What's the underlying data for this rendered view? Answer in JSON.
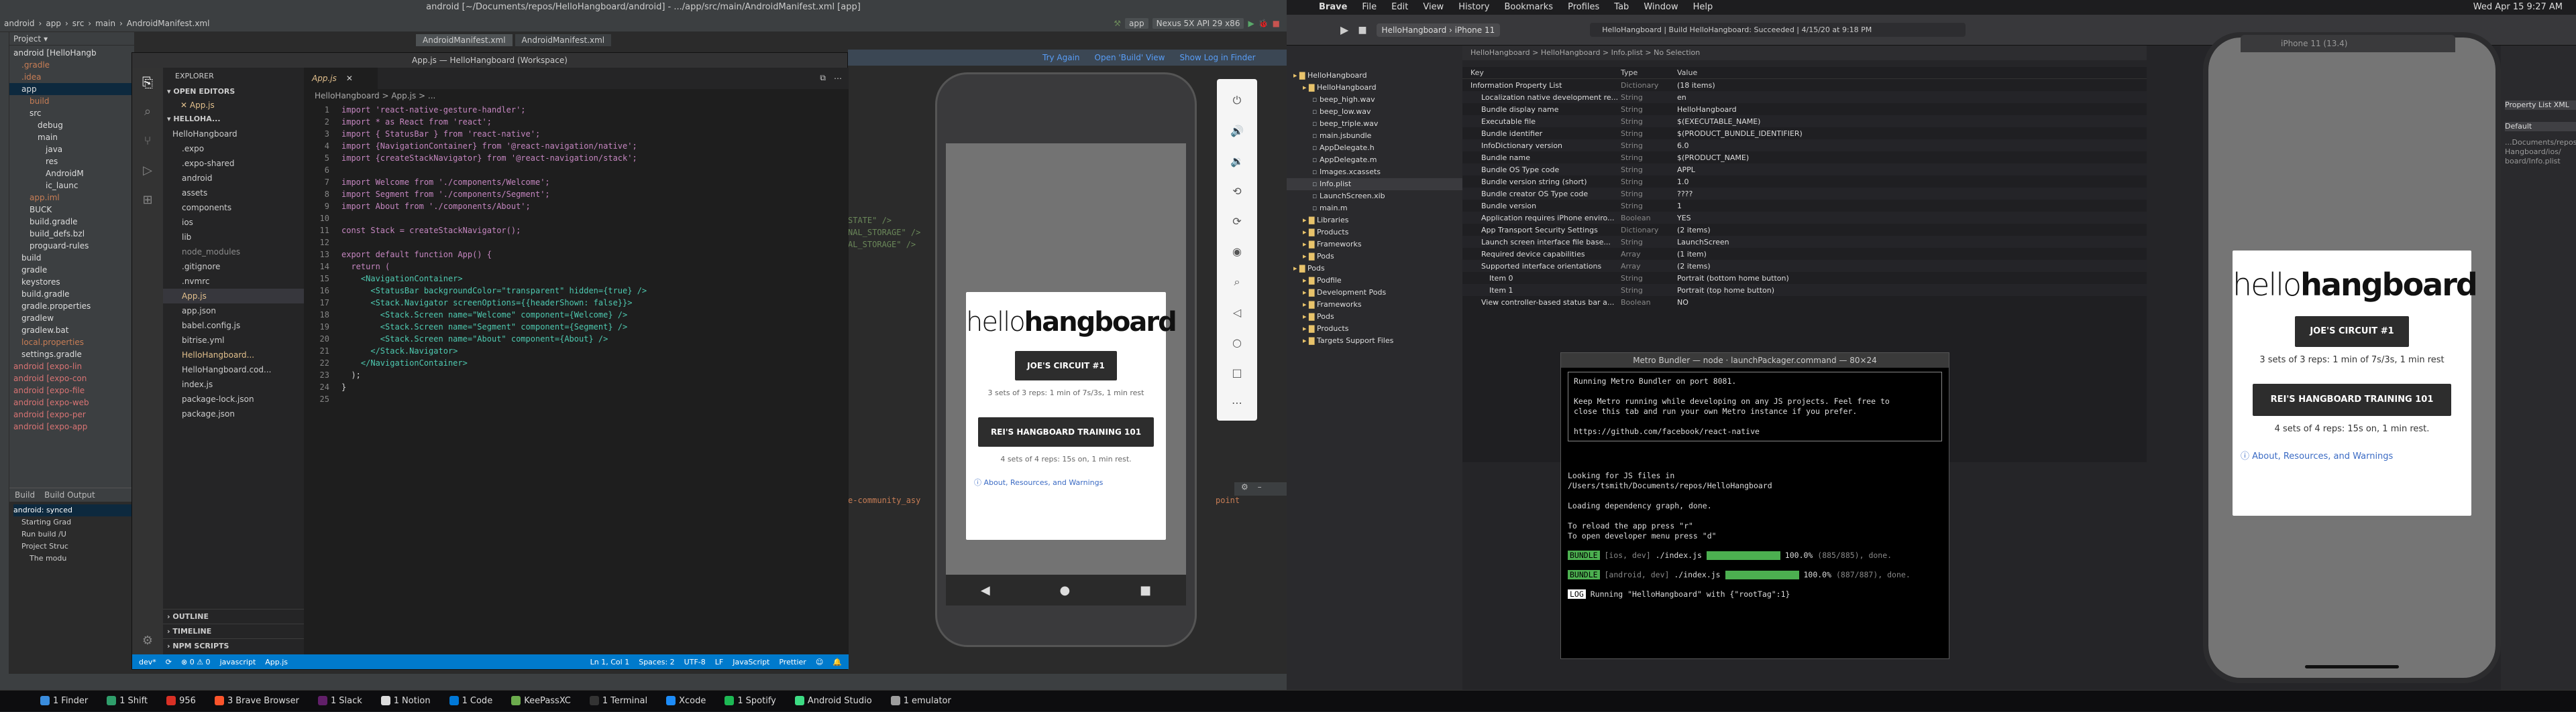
{
  "android_studio": {
    "title": "android [~/Documents/repos/HelloHangboard/android] - .../app/src/main/AndroidManifest.xml [app]",
    "breadcrumbs": [
      "android",
      "app",
      "src",
      "main",
      "AndroidManifest.xml"
    ],
    "run_config": "app",
    "device": "Nexus 5X API 29 x86",
    "editor_tabs": [
      "AndroidManifest.xml",
      "AndroidManifest.xml"
    ],
    "notice": {
      "try_again": "Try Again",
      "open_build": "Open 'Build' View",
      "show_log": "Show Log in Finder"
    },
    "project_label": "Project",
    "project_tree": [
      "android [HelloHangb",
      ".gradle",
      ".idea",
      "app",
      "build",
      "src",
      "debug",
      "main",
      "java",
      "res",
      "AndroidM",
      "ic_launc",
      "app.iml",
      "BUCK",
      "build.gradle",
      "build_defs.bzl",
      "proguard-rules",
      "build",
      "gradle",
      "keystores",
      "build.gradle",
      "gradle.properties",
      "gradlew",
      "gradlew.bat",
      "local.properties",
      "settings.gradle",
      "android [expo-lin",
      "android [expo-con",
      "android [expo-file",
      "android [expo-web",
      "android [expo-per",
      "android [expo-app"
    ],
    "build_tabs": [
      "Build",
      "Build Output"
    ],
    "build_tree": [
      "android: synced",
      "Starting Grad",
      "Run build /U",
      "Project Struc",
      "The modu"
    ],
    "code_fragments": [
      "STATE\" />",
      "NAL_STORAGE\" />",
      "AL_STORAGE\" />",
      "e-community_asy",
      "point"
    ]
  },
  "vscode": {
    "title": "App.js — HelloHangboard (Workspace)",
    "explorer_label": "EXPLORER",
    "open_editors_label": "OPEN EDITORS",
    "open_editor_file": "App.js",
    "workspace_label": "HELLOHA...",
    "files": [
      "HelloHangboard",
      ".expo",
      ".expo-shared",
      "android",
      "assets",
      "components",
      "ios",
      "lib",
      "node_modules",
      ".gitignore",
      ".nvmrc",
      "App.js",
      "app.json",
      "babel.config.js",
      "bitrise.yml",
      "HelloHangboard...",
      "HelloHangboard.cod...",
      "index.js",
      "package-lock.json",
      "package.json"
    ],
    "tab": "App.js",
    "breadcrumb": "HelloHangboard > App.js > ...",
    "code": [
      "import 'react-native-gesture-handler';",
      "import * as React from 'react';",
      "import { StatusBar } from 'react-native';",
      "import {NavigationContainer} from '@react-navigation/native';",
      "import {createStackNavigator} from '@react-navigation/stack';",
      "",
      "import Welcome from './components/Welcome';",
      "import Segment from './components/Segment';",
      "import About from './components/About';",
      "",
      "const Stack = createStackNavigator();",
      "",
      "export default function App() {",
      "  return (",
      "    <NavigationContainer>",
      "      <StatusBar backgroundColor=\"transparent\" hidden={true} />",
      "      <Stack.Navigator screenOptions={{headerShown: false}}>",
      "        <Stack.Screen name=\"Welcome\" component={Welcome} />",
      "        <Stack.Screen name=\"Segment\" component={Segment} />",
      "        <Stack.Screen name=\"About\" component={About} />",
      "      </Stack.Navigator>",
      "    </NavigationContainer>",
      "  );",
      "}",
      ""
    ],
    "outline_sections": [
      "OUTLINE",
      "TIMELINE",
      "NPM SCRIPTS"
    ],
    "status": {
      "branch": "dev*",
      "lang_indicator": "javascript",
      "file": "App.js",
      "position": "Ln 1, Col 1",
      "spaces": "Spaces: 2",
      "encoding": "UTF-8",
      "eol": "LF",
      "language": "JavaScript",
      "prettier": "Prettier"
    }
  },
  "app": {
    "logo_light": "hello",
    "logo_bold": "hangboard",
    "circuit_button": "JOE'S CIRCUIT #1",
    "circuit_desc": "3 sets of 3 reps: 1 min of 7s/3s, 1 min rest",
    "training_button": "REI'S HANGBOARD TRAINING 101",
    "training_desc": "4 sets of 4 reps: 15s on, 1 min rest.",
    "about_link": "About, Resources, and Warnings"
  },
  "mac_menu": [
    "Brave",
    "File",
    "Edit",
    "View",
    "History",
    "Bookmarks",
    "Profiles",
    "Tab",
    "Window",
    "Help"
  ],
  "mac_clock": "Wed Apr 15  9:27 AM",
  "xcode": {
    "scheme": "HelloHangboard",
    "device": "iPhone 11",
    "status": "HelloHangboard | Build HelloHangboard: Succeeded | 4/15/20 at 9:18 PM",
    "breadcrumb": "HelloHangboard > HelloHangboard > Info.plist > No Selection",
    "nav": [
      "HelloHangboard",
      "HelloHangboard",
      "beep_high.wav",
      "beep_low.wav",
      "beep_triple.wav",
      "main.jsbundle",
      "AppDelegate.h",
      "AppDelegate.m",
      "Images.xcassets",
      "Info.plist",
      "LaunchScreen.xib",
      "main.m",
      "Libraries",
      "Products",
      "Frameworks",
      "Pods",
      "Pods",
      "Podfile",
      "Development Pods",
      "Frameworks",
      "Pods",
      "Products",
      "Targets Support Files"
    ],
    "plist_headers": [
      "Key",
      "Type",
      "Value"
    ],
    "plist_rows": [
      [
        "Information Property List",
        "Dictionary",
        "(18 items)"
      ],
      [
        "Localization native development re...",
        "String",
        "en"
      ],
      [
        "Bundle display name",
        "String",
        "HelloHangboard"
      ],
      [
        "Executable file",
        "String",
        "$(EXECUTABLE_NAME)"
      ],
      [
        "Bundle identifier",
        "String",
        "$(PRODUCT_BUNDLE_IDENTIFIER)"
      ],
      [
        "InfoDictionary version",
        "String",
        "6.0"
      ],
      [
        "Bundle name",
        "String",
        "$(PRODUCT_NAME)"
      ],
      [
        "Bundle OS Type code",
        "String",
        "APPL"
      ],
      [
        "Bundle version string (short)",
        "String",
        "1.0"
      ],
      [
        "Bundle creator OS Type code",
        "String",
        "????"
      ],
      [
        "Bundle version",
        "String",
        "1"
      ],
      [
        "Application requires iPhone enviro...",
        "Boolean",
        "YES"
      ],
      [
        "App Transport Security Settings",
        "Dictionary",
        "(2 items)"
      ],
      [
        "Launch screen interface file base...",
        "String",
        "LaunchScreen"
      ],
      [
        "Required device capabilities",
        "Array",
        "(1 item)"
      ],
      [
        "Supported interface orientations",
        "Array",
        "(2 items)"
      ],
      [
        "Item 0",
        "String",
        "Portrait (bottom home button)"
      ],
      [
        "Item 1",
        "String",
        "Portrait (top home button)"
      ],
      [
        "View controller-based status bar a...",
        "Boolean",
        "NO"
      ]
    ],
    "inspector": [
      "Property List XML",
      "Default",
      "...Documents/repos/",
      "Hangboard/ios/",
      "board/Info.plist"
    ],
    "simulator_title": "iPhone 11 (13.4)"
  },
  "terminal": {
    "title": "Metro Bundler — node · launchPackager.command — 80×24",
    "lines": [
      "Running Metro Bundler on port 8081.",
      "",
      "Keep Metro running while developing on any JS projects. Feel free to",
      "close this tab and run your own Metro instance if you prefer.",
      "",
      "https://github.com/facebook/react-native",
      "",
      "",
      "Looking for JS files in",
      "   /Users/tsmith/Documents/repos/HelloHangboard",
      "",
      "Loading dependency graph, done.",
      "",
      "To reload the app press \"r\"",
      "To open developer menu press \"d\""
    ],
    "bundle1": {
      "tag": "BUNDLE",
      "target": "[ios, dev]",
      "file": "./index.js",
      "pct": "100.0%",
      "count": "(885/885), done."
    },
    "bundle2": {
      "tag": "BUNDLE",
      "target": "[android, dev]",
      "file": "./index.js",
      "pct": "100.0%",
      "count": "(887/887), done."
    },
    "log_tag": "LOG",
    "log_text": "Running \"HelloHangboard\" with {\"rootTag\":1}"
  },
  "dock": [
    {
      "label": "Finder",
      "count": "1",
      "color": "#3a8dde"
    },
    {
      "label": "Shift",
      "count": "1",
      "color": "#2f9e6b"
    },
    {
      "label": "956",
      "count": "",
      "color": "#d93025"
    },
    {
      "label": "Brave Browser",
      "count": "3",
      "color": "#fb542b"
    },
    {
      "label": "Slack",
      "count": "1",
      "color": "#611f69"
    },
    {
      "label": "Notion",
      "count": "1",
      "color": "#ddd"
    },
    {
      "label": "Code",
      "count": "1",
      "color": "#0078d7"
    },
    {
      "label": "KeePassXC",
      "count": "",
      "color": "#6cac4d"
    },
    {
      "label": "Terminal",
      "count": "1",
      "color": "#333"
    },
    {
      "label": "Xcode",
      "count": "",
      "color": "#1d8cf8"
    },
    {
      "label": "Spotify",
      "count": "1",
      "color": "#1db954"
    },
    {
      "label": "Android Studio",
      "count": "",
      "color": "#3ddc84"
    },
    {
      "label": "emulator",
      "count": "1",
      "color": "#9e9e9e"
    }
  ]
}
